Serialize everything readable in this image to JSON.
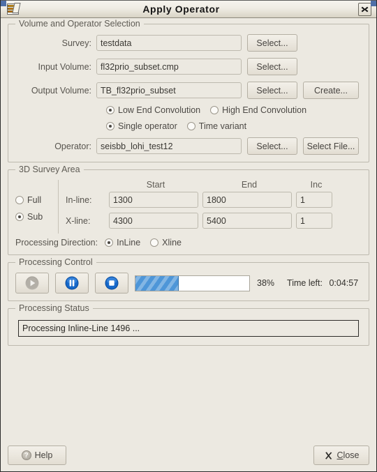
{
  "window": {
    "title": "Apply Operator",
    "icon": "volume-stack-icon",
    "close_icon": "close-icon"
  },
  "volume_group": {
    "legend": "Volume and Operator Selection",
    "survey": {
      "label": "Survey:",
      "value": "testdata",
      "select_label": "Select..."
    },
    "input_volume": {
      "label": "Input Volume:",
      "value": "fl32prio_subset.cmp",
      "select_label": "Select..."
    },
    "output_volume": {
      "label": "Output Volume:",
      "value": "TB_fl32prio_subset",
      "select_label": "Select...",
      "create_label": "Create..."
    },
    "convolution_radios": [
      {
        "label": "Low End Convolution",
        "selected": true
      },
      {
        "label": "High End Convolution",
        "selected": false
      }
    ],
    "operator_mode_radios": [
      {
        "label": "Single operator",
        "selected": true
      },
      {
        "label": "Time variant",
        "selected": false
      }
    ],
    "operator": {
      "label": "Operator:",
      "value": "seisbb_lohi_test12",
      "select_label": "Select...",
      "select_file_label": "Select File..."
    }
  },
  "survey_group": {
    "legend": "3D Survey Area",
    "extent_radios": [
      {
        "label": "Full",
        "selected": false
      },
      {
        "label": "Sub",
        "selected": true
      }
    ],
    "column_headers": {
      "start": "Start",
      "end": "End",
      "inc": "Inc"
    },
    "rows": [
      {
        "label": "In-line:",
        "start": "1300",
        "end": "1800",
        "inc": "1"
      },
      {
        "label": "X-line:",
        "start": "4300",
        "end": "5400",
        "inc": "1"
      }
    ],
    "processing_direction": {
      "label": "Processing Direction:",
      "options": [
        {
          "label": "InLine",
          "selected": true
        },
        {
          "label": "Xline",
          "selected": false
        }
      ]
    }
  },
  "control_group": {
    "legend": "Processing Control",
    "buttons": [
      {
        "name": "play-button",
        "icon": "play-icon",
        "enabled": false
      },
      {
        "name": "pause-button",
        "icon": "pause-icon",
        "enabled": true
      },
      {
        "name": "stop-button",
        "icon": "stop-icon",
        "enabled": true
      }
    ],
    "progress_percent": 38,
    "progress_percent_label": "38%",
    "time_left_label": "Time left:",
    "time_left_value": "0:04:57"
  },
  "status_group": {
    "legend": "Processing Status",
    "message": "Processing Inline-Line 1496 ..."
  },
  "footer": {
    "help_label": "Help",
    "close_label_prefix": "C",
    "close_label_rest": "lose",
    "close_icon": "x-mark-icon"
  },
  "colors": {
    "dialog_bg": "#ece9e1",
    "progress_fill": "#4e96d8",
    "control_button_blue": "#1465c0",
    "border": "#bdb9ae"
  }
}
